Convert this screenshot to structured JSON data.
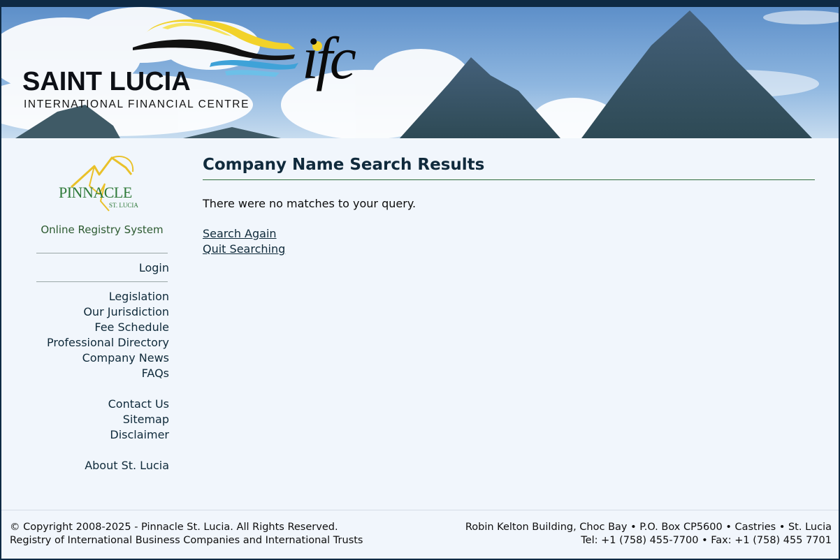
{
  "banner": {
    "brand_name": "SAINT LUCIA",
    "brand_subtitle": "INTERNATIONAL FINANCIAL CENTRE",
    "ifc_logo_text": "ifc"
  },
  "sidebar": {
    "logo_name": "PINNACLE",
    "logo_subtitle": "ST. LUCIA",
    "system_label": "Online Registry System",
    "login": "Login",
    "nav_group_1": [
      "Legislation",
      "Our Jurisdiction",
      "Fee Schedule",
      "Professional Directory",
      "Company News",
      "FAQs"
    ],
    "nav_group_2": [
      "Contact Us",
      "Sitemap",
      "Disclaimer"
    ],
    "nav_group_3": [
      "About St. Lucia"
    ]
  },
  "main": {
    "title": "Company Name Search Results",
    "message": "There were no matches to your query.",
    "search_again": "Search Again",
    "quit_searching": "Quit Searching"
  },
  "footer": {
    "copyright": "© Copyright 2008-2025 - Pinnacle St. Lucia. All Rights Reserved.",
    "registry_line": "Registry of International Business Companies and International Trusts",
    "address": "Robin Kelton Building, Choc Bay • P.O. Box CP5600 • Castries • St. Lucia",
    "contact": "Tel: +1 (758) 455-7700 • Fax: +1 (758) 455 7701"
  },
  "colors": {
    "page_border": "#0e2a44",
    "content_bg": "#f1f6fc",
    "title_rule": "#2f6b3c",
    "link": "#0f2a3a",
    "logo_green": "#2f7a39"
  }
}
